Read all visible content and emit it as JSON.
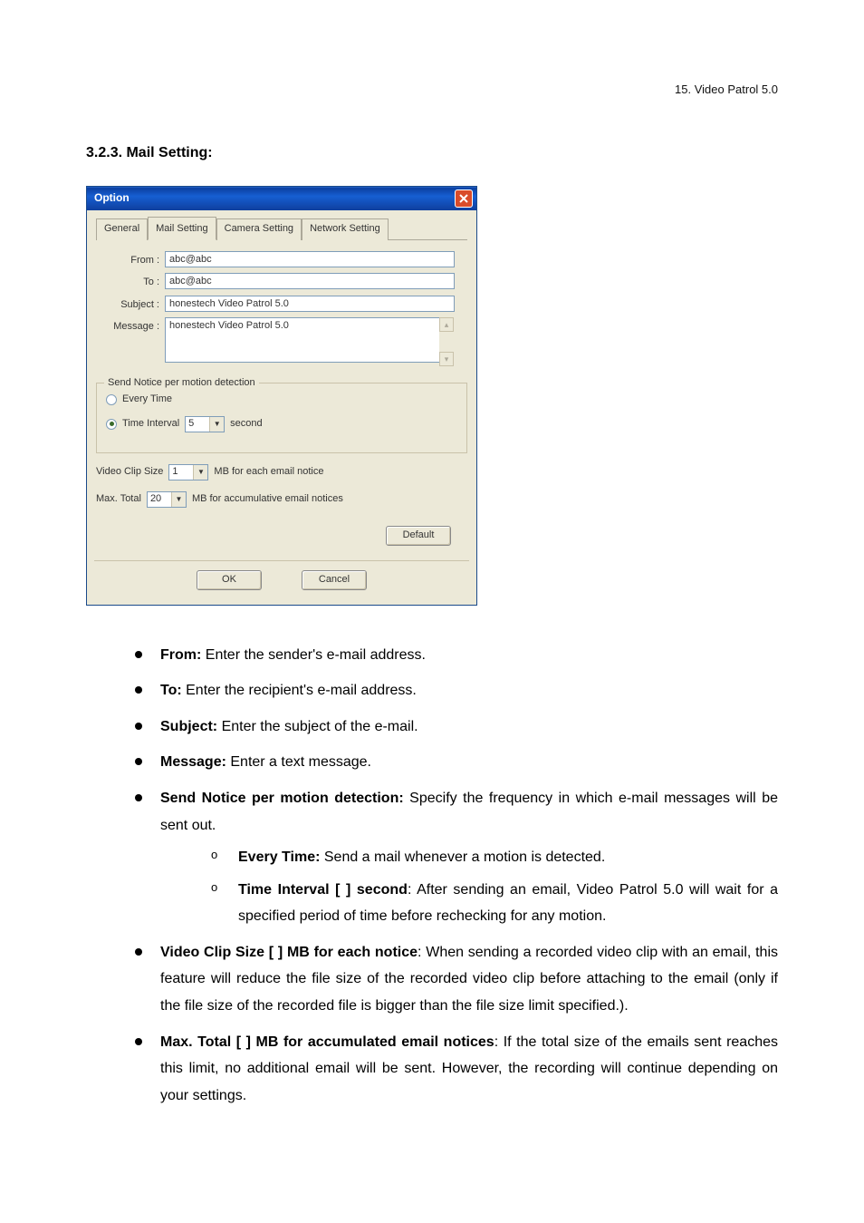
{
  "header": {
    "text": "15. Video Patrol 5.0"
  },
  "section": {
    "title": "3.2.3. Mail Setting:"
  },
  "dialog": {
    "title": "Option",
    "tabs": [
      "General",
      "Mail Setting",
      "Camera Setting",
      "Network Setting"
    ],
    "from_label": "From :",
    "from_value": "abc@abc",
    "to_label": "To :",
    "to_value": "abc@abc",
    "subject_label": "Subject :",
    "subject_value": "honestech Video Patrol 5.0",
    "message_label": "Message :",
    "message_value": "honestech Video Patrol 5.0",
    "fieldset_legend": "Send Notice per motion detection",
    "radio_every": "Every Time",
    "radio_interval": "Time Interval",
    "interval_value": "5",
    "interval_unit": "second",
    "clipsize_prefix": "Video Clip Size",
    "clipsize_value": "1",
    "clipsize_suffix": "MB for each email notice",
    "maxtotal_prefix": "Max. Total",
    "maxtotal_value": "20",
    "maxtotal_suffix": "MB for accumulative email notices",
    "default_btn": "Default",
    "ok_btn": "OK",
    "cancel_btn": "Cancel"
  },
  "desc": {
    "from_b": "From:",
    "from_t": " Enter the sender's e-mail address.",
    "to_b": "To:",
    "to_t": " Enter the recipient's e-mail address.",
    "subject_b": "Subject:",
    "subject_t": " Enter the subject of the e-mail.",
    "message_b": "Message:",
    "message_t": " Enter a text message.",
    "send_b": "Send Notice per motion detection:",
    "send_t": " Specify the frequency in which e-mail messages will be sent out.",
    "every_b": "Every Time:",
    "every_t": " Send a mail whenever a motion is detected.",
    "interval_b": "Time Interval [ ] second",
    "interval_t": ": After sending an email, Video Patrol 5.0 will wait for a specified period of time before rechecking for any motion.",
    "clip_b": "Video Clip Size [ ] MB for each notice",
    "clip_t": ": When sending a recorded video clip with an email, this feature will reduce the file size of the recorded video clip before attaching to the email (only if the file size of the recorded file is bigger than the file size limit specified.).",
    "max_b": "Max. Total [ ] MB for accumulated email notices",
    "max_t": ": If the total size of the emails sent reaches this limit, no additional email will be sent.  However, the recording will continue depending on your settings."
  }
}
